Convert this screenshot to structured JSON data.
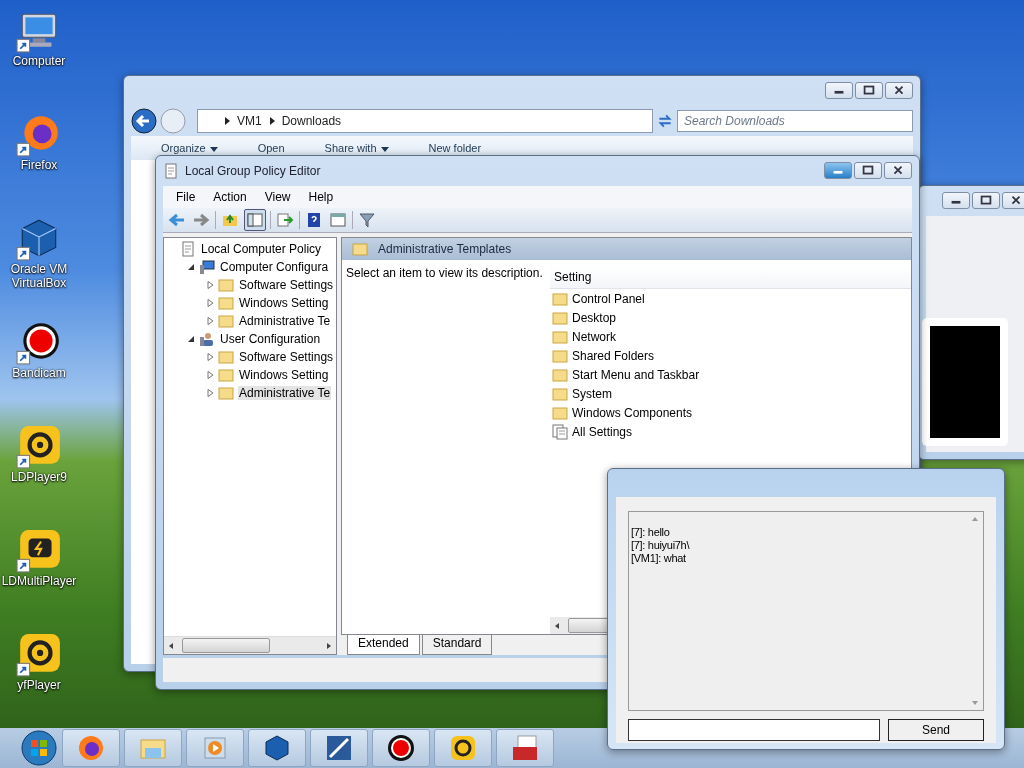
{
  "desktop_icons": [
    {
      "label": "Computer",
      "kind": "computer"
    },
    {
      "label": "Firefox",
      "kind": "firefox"
    },
    {
      "label": "Oracle VM VirtualBox",
      "kind": "virtualbox"
    },
    {
      "label": "Bandicam",
      "kind": "record"
    },
    {
      "label": "LDPlayer9",
      "kind": "ldplayer"
    },
    {
      "label": "LDMultiPlayer",
      "kind": "ldmulti"
    },
    {
      "label": "yfPlayer",
      "kind": "ldplayer"
    }
  ],
  "explorer": {
    "breadcrumb": [
      "VM1",
      "Downloads"
    ],
    "search_placeholder": "Search Downloads",
    "toolbar": [
      {
        "label": "Organize",
        "dropdown": true
      },
      {
        "label": "Open",
        "dropdown": false
      },
      {
        "label": "Share with",
        "dropdown": true
      },
      {
        "label": "New folder",
        "dropdown": false
      }
    ]
  },
  "policy_editor": {
    "title": "Local Group Policy Editor",
    "menu": [
      "File",
      "Action",
      "View",
      "Help"
    ],
    "tree": [
      {
        "label": "Local Computer Policy",
        "kind": "policy",
        "selected": false,
        "children": [
          {
            "label": "Computer Configura",
            "kind": "computer",
            "expanded": true,
            "selected": false,
            "children": [
              {
                "label": "Software Settings",
                "kind": "folder",
                "expanded": false,
                "selected": false
              },
              {
                "label": "Windows Setting",
                "kind": "folder",
                "expanded": false,
                "selected": false
              },
              {
                "label": "Administrative Te",
                "kind": "folder",
                "expanded": false,
                "selected": false
              }
            ]
          },
          {
            "label": "User Configuration",
            "kind": "user",
            "expanded": true,
            "selected": false,
            "children": [
              {
                "label": "Software Settings",
                "kind": "folder",
                "expanded": false,
                "selected": false
              },
              {
                "label": "Windows Setting",
                "kind": "folder",
                "expanded": false,
                "selected": false
              },
              {
                "label": "Administrative Te",
                "kind": "folder",
                "expanded": false,
                "selected": true
              }
            ]
          }
        ]
      }
    ],
    "header": "Administrative Templates",
    "description": "Select an item to view its description.",
    "column": "Setting",
    "items": [
      {
        "label": "Control Panel",
        "kind": "folder"
      },
      {
        "label": "Desktop",
        "kind": "folder"
      },
      {
        "label": "Network",
        "kind": "folder"
      },
      {
        "label": "Shared Folders",
        "kind": "folder"
      },
      {
        "label": "Start Menu and Taskbar",
        "kind": "folder"
      },
      {
        "label": "System",
        "kind": "folder"
      },
      {
        "label": "Windows Components",
        "kind": "folder"
      },
      {
        "label": "All Settings",
        "kind": "settings"
      }
    ],
    "tabs": [
      {
        "label": "Extended",
        "selected": true
      },
      {
        "label": "Standard",
        "selected": false
      }
    ]
  },
  "chat": {
    "messages": [
      "[7]: hello",
      "[7]: huiyui7h\\",
      "[VM1]: what"
    ],
    "send_button": "Send"
  }
}
